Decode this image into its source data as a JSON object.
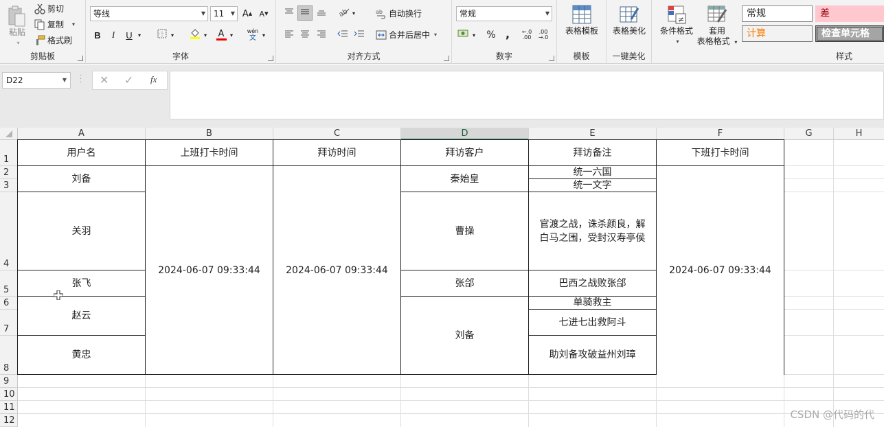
{
  "ribbon": {
    "clipboard": {
      "paste": "粘贴",
      "cut": "剪切",
      "copy": "复制",
      "format_painter": "格式刷",
      "label": "剪贴板"
    },
    "font": {
      "name": "等线",
      "size": "11",
      "bold": "B",
      "italic": "I",
      "underline": "U",
      "font_color_letter": "A",
      "phonetic": "wén",
      "label": "字体"
    },
    "alignment": {
      "wrap_text": "自动换行",
      "merge_center": "合并后居中",
      "label": "对齐方式"
    },
    "number": {
      "format": "常规",
      "percent": "%",
      "comma": ",",
      "inc_decimal": ".00",
      "dec_decimal": ".00",
      "label": "数字"
    },
    "template": {
      "table_template": "表格模板",
      "label": "模板"
    },
    "beautify": {
      "table_beautify": "表格美化",
      "label": "一键美化"
    },
    "styles": {
      "conditional_format": "条件格式",
      "table_format_line1": "套用",
      "table_format_line2": "表格格式",
      "cell_normal": "常规",
      "cell_bad": "差",
      "cell_calc": "计算",
      "cell_check": "检查单元格",
      "label": "样式"
    }
  },
  "formula_bar": {
    "name_box": "D22",
    "fx": "fx",
    "formula": ""
  },
  "grid": {
    "columns": [
      "A",
      "B",
      "C",
      "D",
      "E",
      "F",
      "G",
      "H"
    ],
    "selected_column": "D",
    "rows": [
      "1",
      "2",
      "3",
      "4",
      "5",
      "6",
      "7",
      "8",
      "9",
      "10",
      "11",
      "12"
    ],
    "headers": {
      "a": "用户名",
      "b": "上班打卡时间",
      "c": "拜访时间",
      "d": "拜访客户",
      "e": "拜访备注",
      "f": "下班打卡时间"
    },
    "users": [
      "刘备",
      "关羽",
      "张飞",
      "赵云",
      "黄忠"
    ],
    "clock_in": "2024-06-07 09:33:44",
    "visit_time": "2024-06-07 09:33:44",
    "clock_out": "2024-06-07 09:33:44",
    "customers": [
      "秦始皇",
      "曹操",
      "张郃",
      "刘备"
    ],
    "notes": [
      "统一六国",
      "统一文字",
      "官渡之战，诛杀颜良，解白马之围，受封汉寿亭侯",
      "巴西之战败张郃",
      "单骑救主",
      "七进七出救阿斗",
      "助刘备攻破益州刘璋"
    ]
  },
  "watermark": "CSDN @代码的代"
}
